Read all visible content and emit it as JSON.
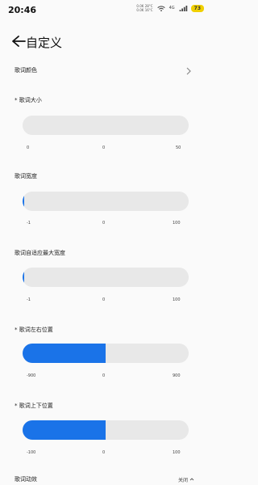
{
  "status_bar": {
    "time": "20:46",
    "net_up": "0.0K",
    "net_up_temp": "28°C",
    "net_down": "0.0K",
    "net_down_temp": "16°C",
    "network": "4G",
    "battery": "73"
  },
  "header": {
    "title": "自定义"
  },
  "color_row": {
    "label": "歌词颜色"
  },
  "sliders": [
    {
      "label": "* 歌词大小",
      "min": "0",
      "current": "0",
      "max": "50",
      "fill_fraction": 0.0
    },
    {
      "label": "歌词宽度",
      "min": "-1",
      "current": "0",
      "max": "100",
      "fill_fraction": 0.01
    },
    {
      "label": "歌词自适应最大宽度",
      "min": "-1",
      "current": "0",
      "max": "100",
      "fill_fraction": 0.01
    },
    {
      "label": "* 歌词左右位置",
      "min": "-900",
      "current": "0",
      "max": "900",
      "fill_fraction": 0.5
    },
    {
      "label": "* 歌词上下位置",
      "min": "-100",
      "current": "0",
      "max": "100",
      "fill_fraction": 0.5
    }
  ],
  "footer": {
    "label": "歌词动效",
    "value": "关闭"
  },
  "colors": {
    "accent": "#1a73e8",
    "track": "#e8e8e8",
    "battery": "#f0d000"
  }
}
